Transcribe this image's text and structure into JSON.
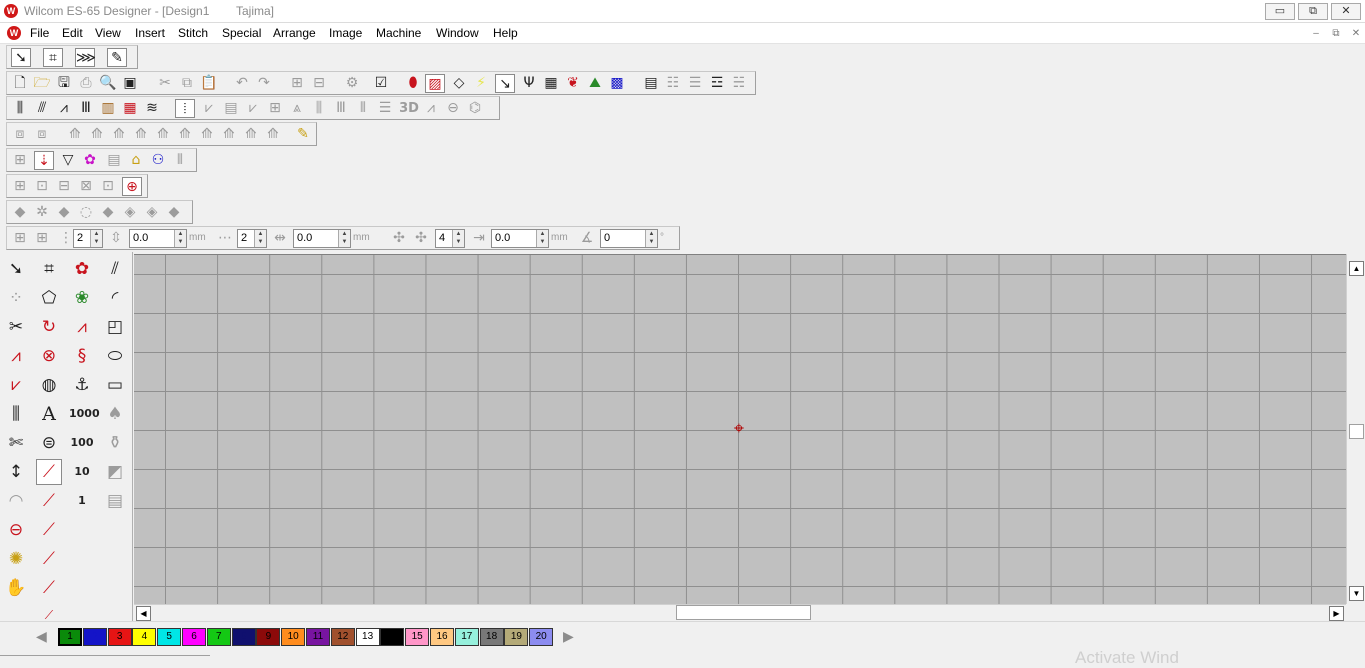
{
  "window": {
    "title": "Wilcom ES-65 Designer - [Design1",
    "machine": "Tajima]",
    "minimize": "▭",
    "restore": "⧉",
    "close": "✕",
    "app_icon": "W"
  },
  "menu": {
    "items": [
      "File",
      "Edit",
      "View",
      "Insert",
      "Stitch",
      "Special",
      "Arrange",
      "Image",
      "Machine",
      "Window",
      "Help"
    ],
    "mdi_min": "–",
    "mdi_restore": "⧉",
    "mdi_close": "✕"
  },
  "values_toolbar": {
    "field1": "2",
    "field2": "0.0",
    "unit2": "mm",
    "field3": "2",
    "field4": "0.0",
    "unit4": "mm",
    "field5": "4",
    "field6": "0.0",
    "unit6": "mm",
    "field7": "0",
    "unit7": "°"
  },
  "toolbox": {
    "letter_tool": "A",
    "num_1000": "1000",
    "num_100": "100",
    "num_10": "10",
    "num_1": "1"
  },
  "toolbar_text": {
    "three_d": "3D"
  },
  "palette": {
    "swatches": [
      {
        "label": "1",
        "color": "#0a8a0a",
        "text": "#000000",
        "selected": true
      },
      {
        "label": "2",
        "color": "#1414c8",
        "text": "#1414c8",
        "selected": false
      },
      {
        "label": "3",
        "color": "#e61414",
        "text": "#000000",
        "selected": false
      },
      {
        "label": "4",
        "color": "#ffff00",
        "text": "#000000",
        "selected": false
      },
      {
        "label": "5",
        "color": "#00e6e6",
        "text": "#000000",
        "selected": false
      },
      {
        "label": "6",
        "color": "#ff00ff",
        "text": "#000000",
        "selected": false
      },
      {
        "label": "7",
        "color": "#14c814",
        "text": "#000000",
        "selected": false
      },
      {
        "label": "8",
        "color": "#10106e",
        "text": "#10106e",
        "selected": false
      },
      {
        "label": "9",
        "color": "#8c0a0a",
        "text": "#000000",
        "selected": false
      },
      {
        "label": "10",
        "color": "#ff8c1e",
        "text": "#000000",
        "selected": false
      },
      {
        "label": "11",
        "color": "#7814a0",
        "text": "#000000",
        "selected": false
      },
      {
        "label": "12",
        "color": "#a0502d",
        "text": "#000000",
        "selected": false
      },
      {
        "label": "13",
        "color": "#ffffff",
        "text": "#000000",
        "selected": false
      },
      {
        "label": "14",
        "color": "#000000",
        "text": "#000000",
        "selected": false
      },
      {
        "label": "15",
        "color": "#ff96c8",
        "text": "#000000",
        "selected": false
      },
      {
        "label": "16",
        "color": "#ffc882",
        "text": "#000000",
        "selected": false
      },
      {
        "label": "17",
        "color": "#96f0dc",
        "text": "#000000",
        "selected": false
      },
      {
        "label": "18",
        "color": "#787878",
        "text": "#000000",
        "selected": false
      },
      {
        "label": "19",
        "color": "#b4aa78",
        "text": "#000000",
        "selected": false
      },
      {
        "label": "20",
        "color": "#8c8cf0",
        "text": "#000000",
        "selected": false
      }
    ],
    "prev_arrow": "◀",
    "next_arrow": "▶"
  },
  "watermark": "Activate Wind"
}
